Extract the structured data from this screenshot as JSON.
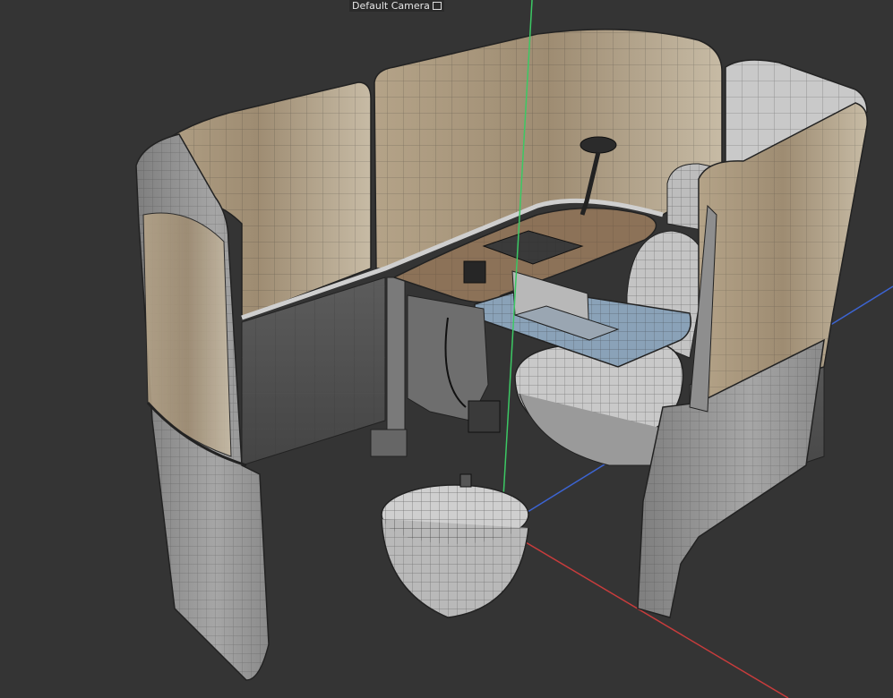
{
  "viewport": {
    "camera_label": "Default Camera",
    "camera_icon": "camera-lock-icon",
    "colors": {
      "background": "#343434",
      "axis_x": "#c83c3c",
      "axis_y": "#3cc864",
      "axis_z": "#3c64d2",
      "panel_fabric": "#a89478",
      "shell": "#9c9c9c",
      "desk_top": "#8c7258"
    }
  }
}
